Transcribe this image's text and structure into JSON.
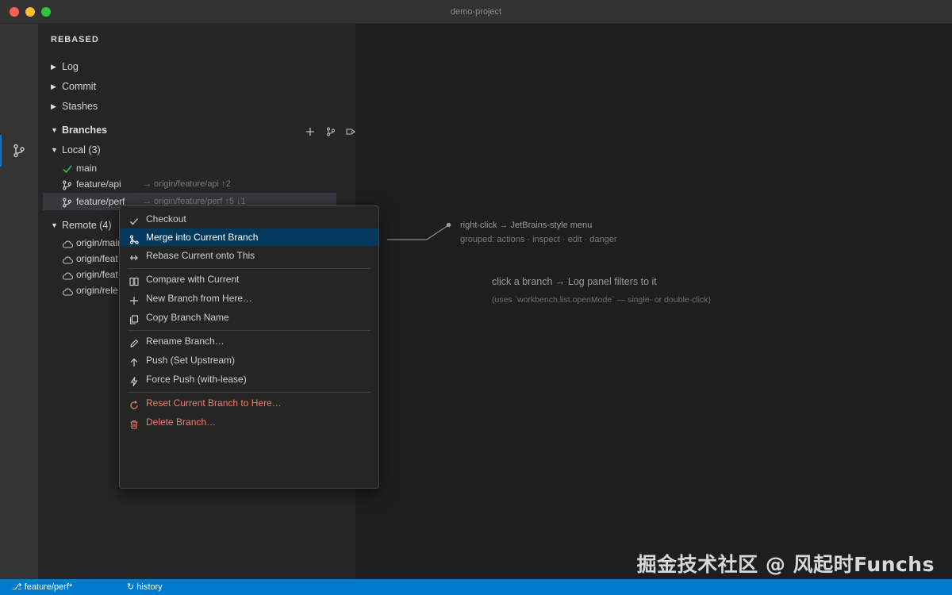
{
  "window": {
    "title": "demo-project"
  },
  "sidebar": {
    "title": "REBASED",
    "sections": {
      "log": "Log",
      "commit": "Commit",
      "stashes": "Stashes",
      "branches": "Branches",
      "local": "Local (3)",
      "remote": "Remote (4)"
    },
    "local_branches": [
      {
        "name": "main",
        "upstream": "",
        "current": true
      },
      {
        "name": "feature/api",
        "upstream": "→ origin/feature/api ↑2"
      },
      {
        "name": "feature/perf",
        "upstream": "→ origin/feature/perf ↑5 ↓1"
      }
    ],
    "remote_branches": [
      "origin/main",
      "origin/feat",
      "origin/feat",
      "origin/rele"
    ]
  },
  "menu": {
    "items": [
      {
        "label": "Checkout",
        "icon": "check-icon"
      },
      {
        "label": "Merge into Current Branch",
        "icon": "merge-icon",
        "active": true
      },
      {
        "label": "Rebase Current onto This",
        "icon": "rebase-icon"
      },
      {
        "label": "Compare with Current",
        "icon": "compare-icon"
      },
      {
        "label": "New Branch from Here…",
        "icon": "plus-icon"
      },
      {
        "label": "Copy Branch Name",
        "icon": "copy-icon"
      },
      {
        "label": "Rename Branch…",
        "icon": "pencil-icon"
      },
      {
        "label": "Push (Set Upstream)",
        "icon": "arrow-up-icon"
      },
      {
        "label": "Force Push (with-lease)",
        "icon": "bolt-icon"
      },
      {
        "label": "Reset Current Branch to Here…",
        "icon": "reset-icon",
        "danger": true
      },
      {
        "label": "Delete Branch…",
        "icon": "trash-icon",
        "danger": true
      }
    ]
  },
  "editor": {
    "note1": "right-click → JetBrains-style menu",
    "note2": "grouped: actions · inspect · edit · danger",
    "note3": "click a branch → Log panel filters to it",
    "note4": "(uses `workbench.list.openMode` — single- or double-click)",
    "watermark": "掘金技术社区 @ 风起时Funchs"
  },
  "statusbar": {
    "branch": "⎇ feature/perf*",
    "history": "↻ history"
  },
  "colors": {
    "accent": "#007acc",
    "menu_active": "#04395e",
    "danger": "#f07d6a",
    "check": "#3fb950"
  }
}
